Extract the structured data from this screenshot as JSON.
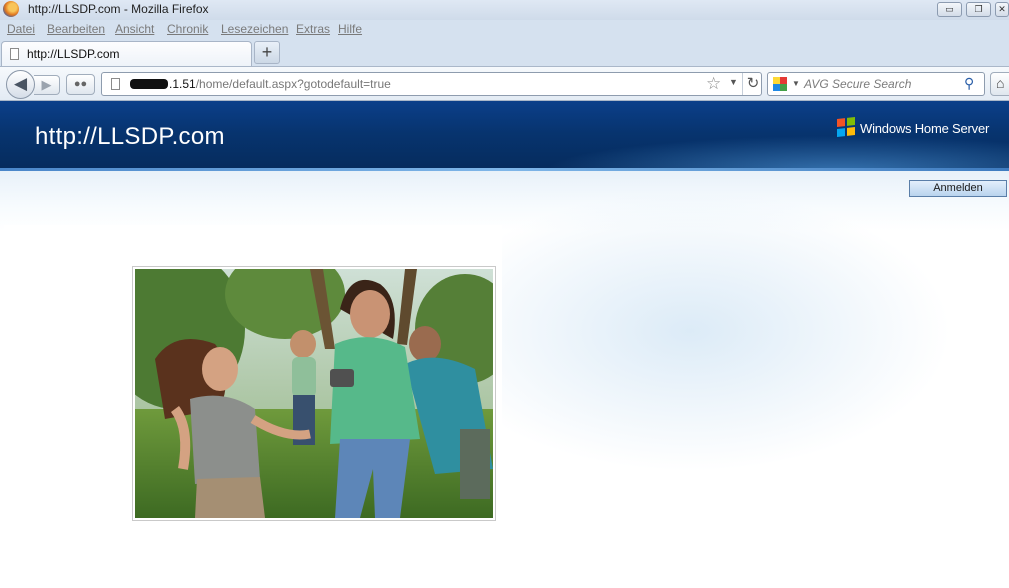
{
  "window": {
    "title": "http://LLSDP.com - Mozilla Firefox",
    "controls": {
      "minimize": "▭",
      "restore": "❐",
      "close": "✕"
    }
  },
  "menu": [
    "Datei",
    "Bearbeiten",
    "Ansicht",
    "Chronik",
    "Lesezeichen",
    "Extras",
    "Hilfe"
  ],
  "tab": {
    "label": "http://LLSDP.com",
    "new_tab": "+"
  },
  "nav": {
    "back": "◀",
    "forward": "▶",
    "url_host_suffix": ".1.51",
    "url_path": "/home/default.aspx?gotodefault=true",
    "search_placeholder": "AVG Secure Search"
  },
  "icons": {
    "firefox": "firefox-icon",
    "back": "back-arrow-icon",
    "forward": "forward-arrow-icon",
    "star": "bookmark-star-icon",
    "reload": "reload-icon",
    "search": "magnifier-icon",
    "home": "home-icon",
    "windows_flag": "windows-flag-icon"
  },
  "page": {
    "site_title": "http://LLSDP.com",
    "brand": "Windows Home Server",
    "login_button": "Anmelden"
  },
  "colors": {
    "header_dark": "#062b5c",
    "header_mid": "#0b3f8a",
    "login_border": "#5a7ea8"
  }
}
